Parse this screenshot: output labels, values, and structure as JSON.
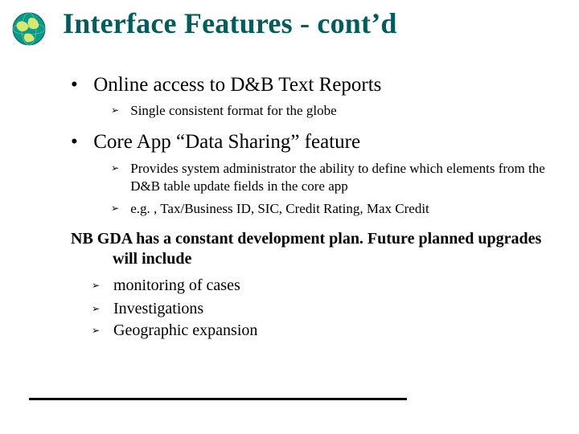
{
  "title": "Interface Features - cont’d",
  "bullets": {
    "b1": "Online access to D&B Text Reports",
    "b1_sub1": "Single consistent format for the globe",
    "b2": "Core App “Data Sharing” feature",
    "b2_sub1": "Provides system administrator the ability to define which elements from the D&B table update fields in the core app",
    "b2_sub2": "e.g. , Tax/Business ID, SIC, Credit Rating, Max Credit",
    "nb_line1": "NB GDA has a constant development plan. Future planned upgrades",
    "nb_line2": "will include",
    "nb_sub1": "monitoring of cases",
    "nb_sub2": "Investigations",
    "nb_sub3": "Geographic expansion"
  },
  "glyphs": {
    "dot": "•",
    "arrow": "➢"
  }
}
